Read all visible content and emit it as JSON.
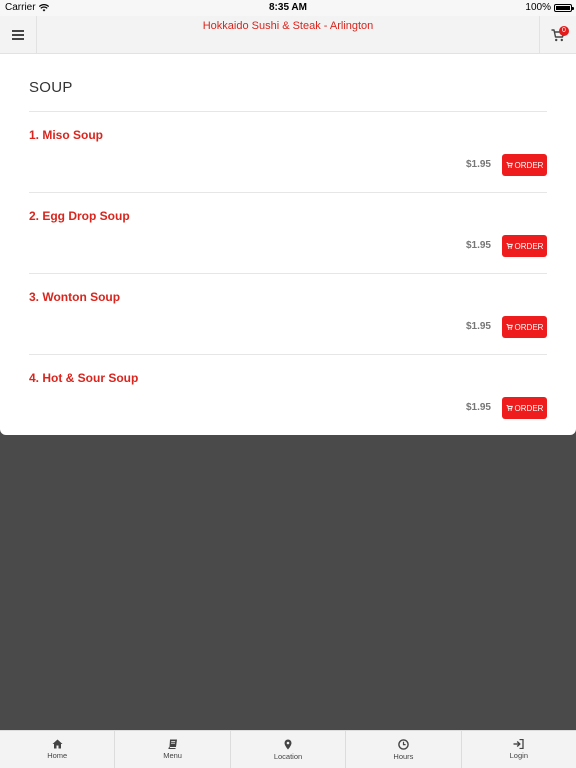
{
  "status_bar": {
    "carrier": "Carrier",
    "time": "8:35 AM",
    "battery": "100%"
  },
  "header": {
    "title": "Hokkaido Sushi & Steak - Arlington",
    "cart_count": "0",
    "menu_icon": "hamburger-icon",
    "cart_icon": "cart-icon"
  },
  "section": {
    "title": "SOUP"
  },
  "items": [
    {
      "name": "1. Miso Soup",
      "price": "$1.95",
      "order_label": "ORDER"
    },
    {
      "name": "2. Egg Drop Soup",
      "price": "$1.95",
      "order_label": "ORDER"
    },
    {
      "name": "3. Wonton Soup",
      "price": "$1.95",
      "order_label": "ORDER"
    },
    {
      "name": "4. Hot & Sour Soup",
      "price": "$1.95",
      "order_label": "ORDER"
    }
  ],
  "tabs": [
    {
      "label": "Home",
      "icon": "home-icon"
    },
    {
      "label": "Menu",
      "icon": "book-icon"
    },
    {
      "label": "Location",
      "icon": "map-pin-icon"
    },
    {
      "label": "Hours",
      "icon": "clock-icon"
    },
    {
      "label": "Login",
      "icon": "login-icon"
    }
  ],
  "colors": {
    "accent": "#d9251d",
    "button": "#ee1c1c",
    "backdrop": "#4a4a4a"
  }
}
